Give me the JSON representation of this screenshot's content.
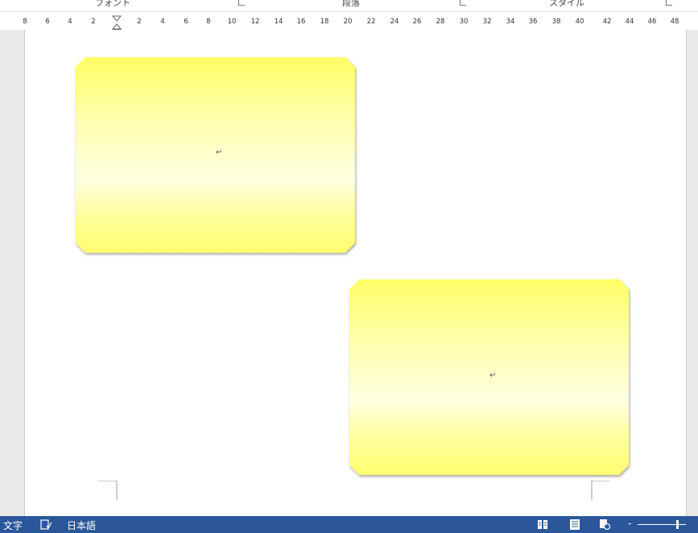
{
  "ribbon": {
    "groups": [
      "フォント",
      "段落",
      "スタイル"
    ]
  },
  "ruler": {
    "ticks": [
      "8",
      "6",
      "4",
      "2",
      "2",
      "4",
      "6",
      "8",
      "10",
      "12",
      "14",
      "16",
      "18",
      "20",
      "22",
      "24",
      "26",
      "28",
      "30",
      "32",
      "34",
      "36",
      "38",
      "40",
      "42",
      "44",
      "46",
      "48"
    ]
  },
  "document": {
    "shapes": [
      {
        "name": "shape-top-left",
        "paragraph_mark": "↵"
      },
      {
        "name": "shape-bottom-right",
        "paragraph_mark": "↵"
      }
    ],
    "fill_colors": {
      "top": "#ffff66",
      "middle": "#ffffe2",
      "bottom": "#ffff70"
    }
  },
  "statusbar": {
    "word_count_label": "文字",
    "language": "日本語",
    "background": "#2b579a",
    "icons": [
      "proofing-icon",
      "read-mode-icon",
      "print-layout-icon",
      "web-layout-icon"
    ],
    "zoom_controls": [
      "zoom-out-button",
      "zoom-slider"
    ]
  }
}
